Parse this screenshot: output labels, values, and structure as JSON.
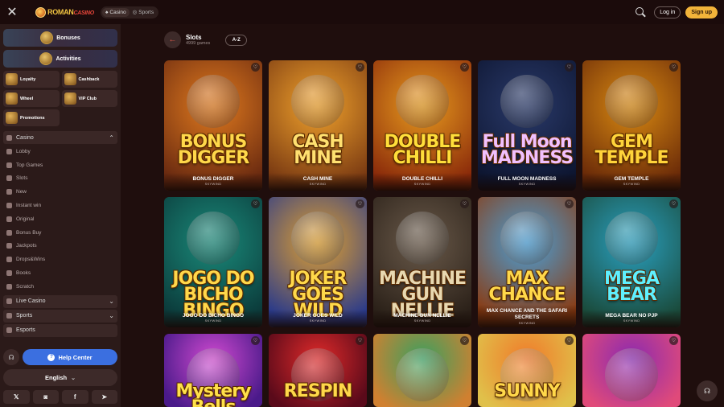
{
  "header": {
    "logo_main": "ROMAN",
    "logo_sub": "CASINO",
    "modes": [
      {
        "label": "Casino"
      },
      {
        "label": "Sports"
      }
    ],
    "login_label": "Log in",
    "signup_label": "Sign up"
  },
  "sidebar": {
    "bonuses_label": "Bonuses",
    "activities_label": "Activities",
    "quick": [
      {
        "label": "Loyalty"
      },
      {
        "label": "Cashback"
      },
      {
        "label": "Wheel"
      },
      {
        "label": "VIP Club"
      }
    ],
    "promotions_label": "Promotions",
    "casino_label": "Casino",
    "casino_items": [
      {
        "label": "Lobby"
      },
      {
        "label": "Top Games"
      },
      {
        "label": "Slots"
      },
      {
        "label": "New"
      },
      {
        "label": "Instant win"
      },
      {
        "label": "Original"
      },
      {
        "label": "Bonus Buy"
      },
      {
        "label": "Jackpots"
      },
      {
        "label": "Drops&Wins"
      },
      {
        "label": "Books"
      },
      {
        "label": "Scratch"
      }
    ],
    "live_casino_label": "Live Casino",
    "sports_label": "Sports",
    "esports_label": "Esports",
    "help_label": "Help Center",
    "language_label": "English"
  },
  "page": {
    "title": "Slots",
    "count": "4999 games",
    "sort_label": "A-Z"
  },
  "games": [
    {
      "name": "BONUS DIGGER",
      "provider": "SKYWIND",
      "art_title": "BONUS DIGGER",
      "bg": "#e07a1e",
      "bg2": "#6a2a10",
      "title_color": "#ffd84a"
    },
    {
      "name": "CASH MINE",
      "provider": "SKYWIND",
      "art_title": "CASH MINE",
      "bg": "#f0a22c",
      "bg2": "#7a3a12",
      "title_color": "#ffe070"
    },
    {
      "name": "DOUBLE CHILLI",
      "provider": "SKYWIND",
      "art_title": "DOUBLE CHILLI",
      "bg": "#e79a1e",
      "bg2": "#8a2a0a",
      "title_color": "#ffde3a"
    },
    {
      "name": "FULL MOON MADNESS",
      "provider": "SKYWIND",
      "art_title": "Full Moon MADNESS",
      "bg": "#2a3a6a",
      "bg2": "#0d1530",
      "title_color": "#f0c0ff"
    },
    {
      "name": "GEM TEMPLE",
      "provider": "SKYWIND",
      "art_title": "GEM TEMPLE",
      "bg": "#d98a12",
      "bg2": "#6a2a08",
      "title_color": "#ffd43a"
    },
    {
      "name": "JOGO DO BICHO BINGO",
      "provider": "SKYWIND",
      "art_title": "JOGO DO BICHO BINGO",
      "bg": "#1a8a7a",
      "bg2": "#0b3a3a",
      "title_color": "#ffd84a"
    },
    {
      "name": "JOKER GOES WILD",
      "provider": "SKYWIND",
      "art_title": "JOKER GOES WILD",
      "bg": "#e0a030",
      "bg2": "#2a3a8a",
      "title_color": "#ffd84a"
    },
    {
      "name": "MACHINE GUN NELLIE",
      "provider": "SKYWIND",
      "art_title": "MACHINE GUN NELLIE",
      "bg": "#6a5a4a",
      "bg2": "#2a2018",
      "title_color": "#e8d8b0"
    },
    {
      "name": "MAX CHANCE AND THE SAFARI SECRETS",
      "provider": "SKYWIND",
      "art_title": "MAX CHANCE",
      "bg": "#4aa0d8",
      "bg2": "#8a3a10",
      "title_color": "#ffd84a"
    },
    {
      "name": "MEGA BEAR NO PJP",
      "provider": "SKYWIND",
      "art_title": "MEGA BEAR",
      "bg": "#2aa0c0",
      "bg2": "#1a4a3a",
      "title_color": "#5ef0ff"
    },
    {
      "name": "",
      "provider": "",
      "art_title": "Mystery Bells",
      "bg": "#d04ad0",
      "bg2": "#4a1a8a",
      "title_color": "#ffe04a"
    },
    {
      "name": "",
      "provider": "",
      "art_title": "RESPIN",
      "bg": "#e02a2a",
      "bg2": "#5a0a1a",
      "title_color": "#ffd84a"
    },
    {
      "name": "",
      "provider": "",
      "art_title": "",
      "bg": "#3aa060",
      "bg2": "#d08030",
      "title_color": "#ffd84a"
    },
    {
      "name": "",
      "provider": "",
      "art_title": "SUNNY",
      "bg": "#f07a2a",
      "bg2": "#e0c04a",
      "title_color": "#ffd84a"
    },
    {
      "name": "",
      "provider": "",
      "art_title": "",
      "bg": "#8a2ab0",
      "bg2": "#e04a7a",
      "title_color": "#ffd84a"
    }
  ]
}
